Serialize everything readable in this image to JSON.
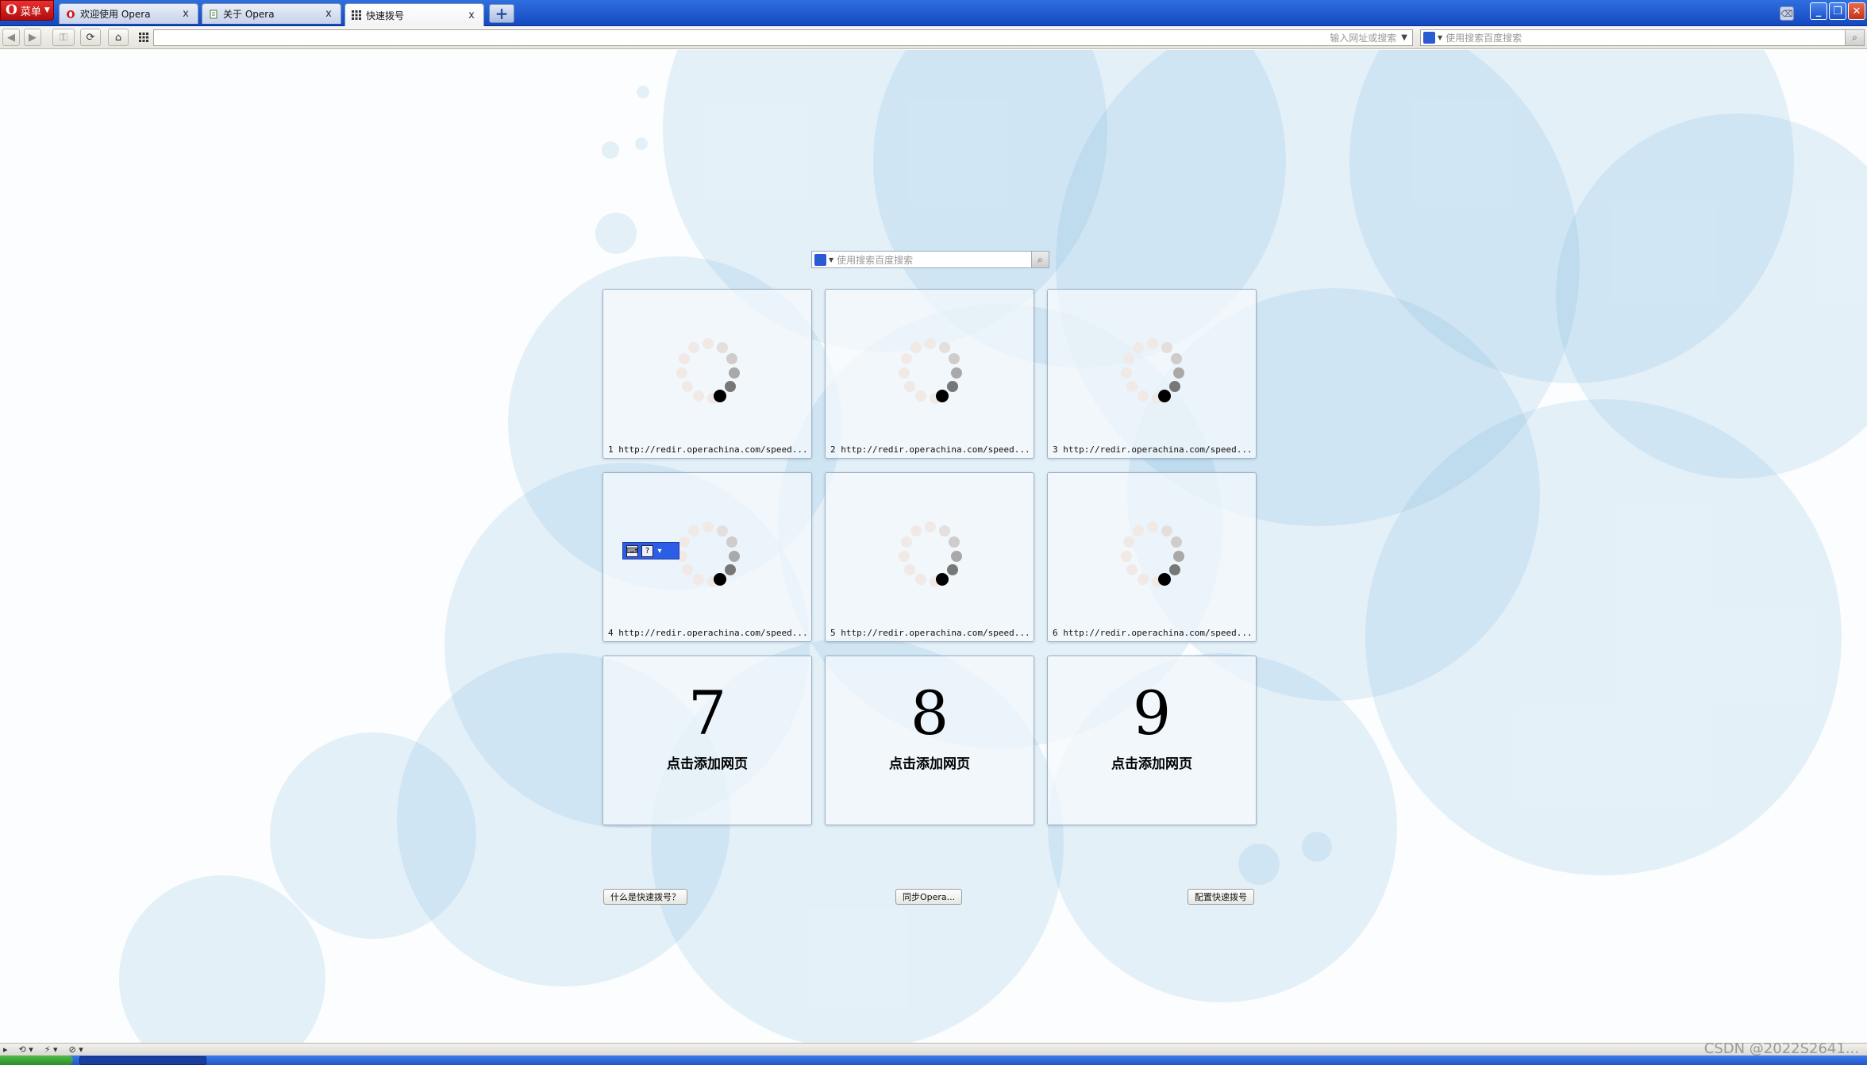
{
  "browser": {
    "menu_label": "菜单",
    "tabs": [
      {
        "label": "欢迎使用 Opera",
        "close": "x"
      },
      {
        "label": "关于 Opera",
        "close": "x"
      },
      {
        "label": "快速拨号",
        "close": "x"
      }
    ],
    "new_tab_label": "+",
    "window_controls": {
      "minimize": "_",
      "restore": "❐",
      "close": "✕"
    }
  },
  "address_bar": {
    "url_placeholder": "输入网址或搜索",
    "search_placeholder": "使用搜索百度搜索"
  },
  "speed_dial": {
    "search_placeholder": "使用搜索百度搜索",
    "dials": [
      {
        "index": "1",
        "url": "1 http://redir.operachina.com/speed..."
      },
      {
        "index": "2",
        "url": "2 http://redir.operachina.com/speed..."
      },
      {
        "index": "3",
        "url": "3 http://redir.operachina.com/speed..."
      },
      {
        "index": "4",
        "url": "4 http://redir.operachina.com/speed..."
      },
      {
        "index": "5",
        "url": "5 http://redir.operachina.com/speed..."
      },
      {
        "index": "6",
        "url": "6 http://redir.operachina.com/speed..."
      },
      {
        "index": "7",
        "add_label": "点击添加网页"
      },
      {
        "index": "8",
        "add_label": "点击添加网页"
      },
      {
        "index": "9",
        "add_label": "点击添加网页"
      }
    ],
    "footer": {
      "help_label": "什么是快速拨号？",
      "sync_label": "同步Opera...",
      "configure_label": "配置快速拨号"
    }
  },
  "watermark": "CSDN @2022S2641...",
  "colors": {
    "tabbar": "#1448c0",
    "menu_button": "#c81818",
    "background_bubbles": "#5aa5d7"
  }
}
